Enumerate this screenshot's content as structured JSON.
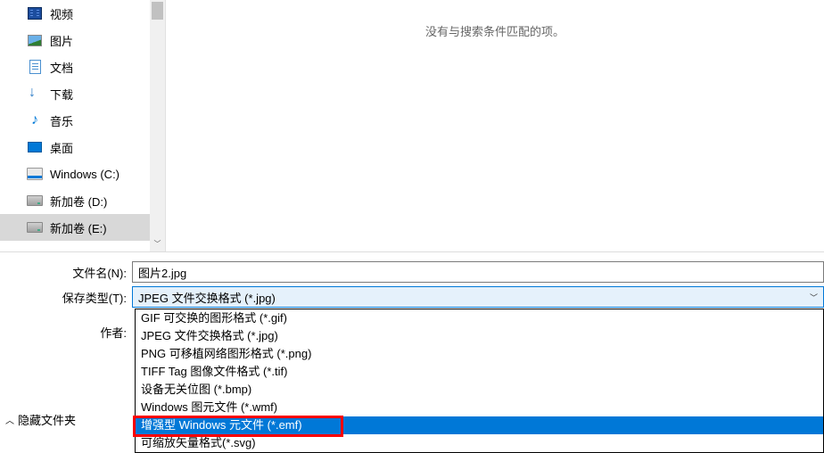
{
  "sidebar": {
    "items": [
      {
        "label": "视频",
        "icon": "video-icon"
      },
      {
        "label": "图片",
        "icon": "picture-icon"
      },
      {
        "label": "文档",
        "icon": "document-icon"
      },
      {
        "label": "下载",
        "icon": "download-icon"
      },
      {
        "label": "音乐",
        "icon": "music-icon"
      },
      {
        "label": "桌面",
        "icon": "desktop-icon"
      },
      {
        "label": "Windows (C:)",
        "icon": "drive-c-icon"
      },
      {
        "label": "新加卷 (D:)",
        "icon": "drive-icon"
      },
      {
        "label": "新加卷 (E:)",
        "icon": "drive-icon",
        "selected": true
      }
    ]
  },
  "content": {
    "empty_message": "没有与搜索条件匹配的项。"
  },
  "form": {
    "filename_label": "文件名(N):",
    "filename_value": "图片2.jpg",
    "savetype_label": "保存类型(T):",
    "savetype_value": "JPEG 文件交换格式 (*.jpg)",
    "author_label": "作者:"
  },
  "dropdown": {
    "options": [
      {
        "label": "GIF 可交换的图形格式 (*.gif)"
      },
      {
        "label": "JPEG 文件交换格式 (*.jpg)"
      },
      {
        "label": "PNG 可移植网络图形格式 (*.png)"
      },
      {
        "label": "TIFF Tag 图像文件格式 (*.tif)"
      },
      {
        "label": "设备无关位图 (*.bmp)"
      },
      {
        "label": "Windows 图元文件 (*.wmf)"
      },
      {
        "label": "增强型 Windows 元文件 (*.emf)",
        "highlighted": true
      },
      {
        "label": "可缩放矢量格式(*.svg)"
      }
    ]
  },
  "bottom": {
    "hide_folders": "隐藏文件夹"
  }
}
